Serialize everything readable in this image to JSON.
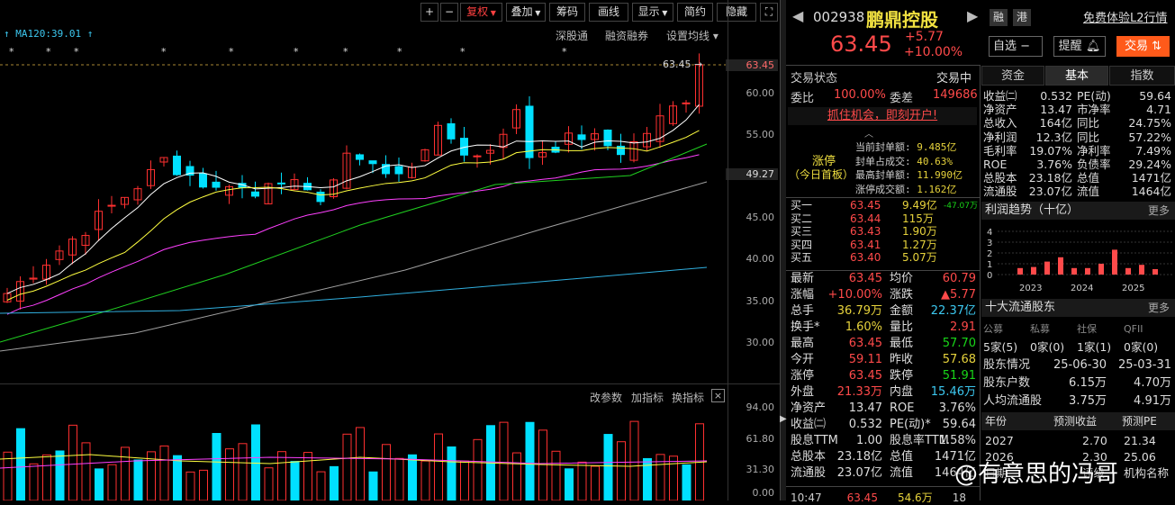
{
  "toolbar": {
    "plus": "+",
    "minus": "−",
    "fuquan": "复权",
    "diejia": "叠加",
    "chouma": "筹码",
    "huaxian": "画线",
    "xianshi": "显示",
    "jianyue": "简约",
    "yincang": "隐藏"
  },
  "chart": {
    "ma120_label": "MA120:39.01",
    "links": [
      "深股通",
      "融资融券",
      "设置均线"
    ],
    "price_marker": "63.45",
    "axis": [
      "63.45",
      "60.00",
      "55.00",
      "49.27",
      "45.00",
      "40.00",
      "35.00",
      "30.00"
    ],
    "vol_axis": [
      "94.00",
      "61.80",
      "31.30",
      "0.00"
    ],
    "vol_links": [
      "改参数",
      "加指标",
      "换指标"
    ],
    "colors": {
      "up": "#ff3030",
      "down": "#00e0ff",
      "ma5": "#ffffff",
      "ma10": "#ffff40",
      "ma20": "#ff40ff",
      "ma30": "#20d020",
      "ma60": "#a0a0a0",
      "ma120": "#30b0e0"
    }
  },
  "quote": {
    "code": "002938",
    "name": "鹏鼎控股",
    "badge1": "融",
    "badge2": "港",
    "promo": "免费体验L2行情",
    "price": "63.45",
    "change": "+5.77",
    "pct": "+10.00%",
    "zixuan": "自选",
    "tixing": "提醒",
    "jiaoyi": "交易"
  },
  "status": {
    "label": "交易状态",
    "value": "交易中",
    "wb_label": "委比",
    "wb": "100.00%",
    "wc_label": "委差",
    "wc": "149686",
    "open_link": "抓住机会，即刻开户!"
  },
  "limit": {
    "title": "涨停",
    "sub": "（今日首板）",
    "rows": [
      [
        "当前封单额:",
        "9.485亿"
      ],
      [
        "封单占成交:",
        "40.63%"
      ],
      [
        "最高封单额:",
        "11.990亿"
      ],
      [
        "涨停成交额:",
        "1.162亿"
      ]
    ]
  },
  "bids": [
    {
      "l": "买一",
      "p": "63.45",
      "v": "9.49亿",
      "x": "-47.07万"
    },
    {
      "l": "买二",
      "p": "63.44",
      "v": "115万",
      "x": ""
    },
    {
      "l": "买三",
      "p": "63.43",
      "v": "1.90万",
      "x": ""
    },
    {
      "l": "买四",
      "p": "63.41",
      "v": "1.27万",
      "x": ""
    },
    {
      "l": "买五",
      "p": "63.40",
      "v": "5.07万",
      "x": ""
    }
  ],
  "stats": [
    [
      "最新",
      "63.45",
      "均价",
      "60.79"
    ],
    [
      "涨幅",
      "+10.00%",
      "涨跌",
      "▲5.77"
    ],
    [
      "总手",
      "36.79万",
      "金额",
      "22.37亿"
    ],
    [
      "换手*",
      "1.60%",
      "量比",
      "2.91"
    ],
    [
      "最高",
      "63.45",
      "最低",
      "57.70"
    ],
    [
      "今开",
      "59.11",
      "昨收",
      "57.68"
    ],
    [
      "涨停",
      "63.45",
      "跌停",
      "51.91"
    ],
    [
      "外盘",
      "21.33万",
      "内盘",
      "15.46万"
    ],
    [
      "净资产",
      "13.47",
      "ROE",
      "3.76%"
    ],
    [
      "收益㈡",
      "0.532",
      "PE(动)*",
      "59.64"
    ],
    [
      "股息TTM",
      "1.00",
      "股息率TTM",
      "1.58%"
    ],
    [
      "总股本",
      "23.18亿",
      "总值",
      "1471亿"
    ],
    [
      "流通股",
      "23.07亿",
      "流值",
      "1464亿"
    ]
  ],
  "last_tick": [
    "10:47",
    "63.45",
    "54.6万",
    "18"
  ],
  "tabs": [
    "资金",
    "基本",
    "指数"
  ],
  "fund": [
    [
      "收益㈡",
      "0.532",
      "PE(动)",
      "59.64"
    ],
    [
      "净资产",
      "13.47",
      "市净率",
      "4.71"
    ],
    [
      "总收入",
      "164亿",
      "同比",
      "24.75%"
    ],
    [
      "净利润",
      "12.3亿",
      "同比",
      "57.22%"
    ],
    [
      "毛利率",
      "19.07%",
      "净利率",
      "7.49%"
    ],
    [
      "ROE",
      "3.76%",
      "负债率",
      "29.24%"
    ],
    [
      "总股本",
      "23.18亿",
      "总值",
      "1471亿"
    ],
    [
      "流通股",
      "23.07亿",
      "流值",
      "1464亿"
    ]
  ],
  "trend": {
    "title": "利润趋势（十亿）",
    "more": "更多",
    "yticks": [
      "4",
      "3",
      "2",
      "1",
      "0"
    ],
    "years": [
      "2023",
      "2024",
      "2025"
    ],
    "values": [
      0.6,
      0.7,
      1.2,
      1.6,
      0.6,
      0.6,
      1.0,
      2.3,
      0.6,
      0.9,
      0.5
    ]
  },
  "holders": {
    "title": "十大流通股东",
    "more": "更多",
    "heads": [
      "公募",
      "私募",
      "社保",
      "QFII"
    ],
    "vals": [
      "5家(5)",
      "0家(0)",
      "1家(1)",
      "0家(0)"
    ],
    "rows": [
      [
        "股东情况",
        "25-06-30",
        "25-03-31"
      ],
      [
        "股东户数",
        "6.15万",
        "4.70万"
      ],
      [
        "人均流通股",
        "3.75万",
        "4.91万"
      ]
    ]
  },
  "forecast": {
    "heads": [
      "年份",
      "预测收益",
      "预测PE"
    ],
    "rows": [
      [
        "2027",
        "2.70",
        "21.34"
      ],
      [
        "2026",
        "2.30",
        "25.06"
      ],
      [
        "日期",
        "评级",
        "机构名称"
      ]
    ]
  },
  "watermark": "@有意思的冯哥"
}
